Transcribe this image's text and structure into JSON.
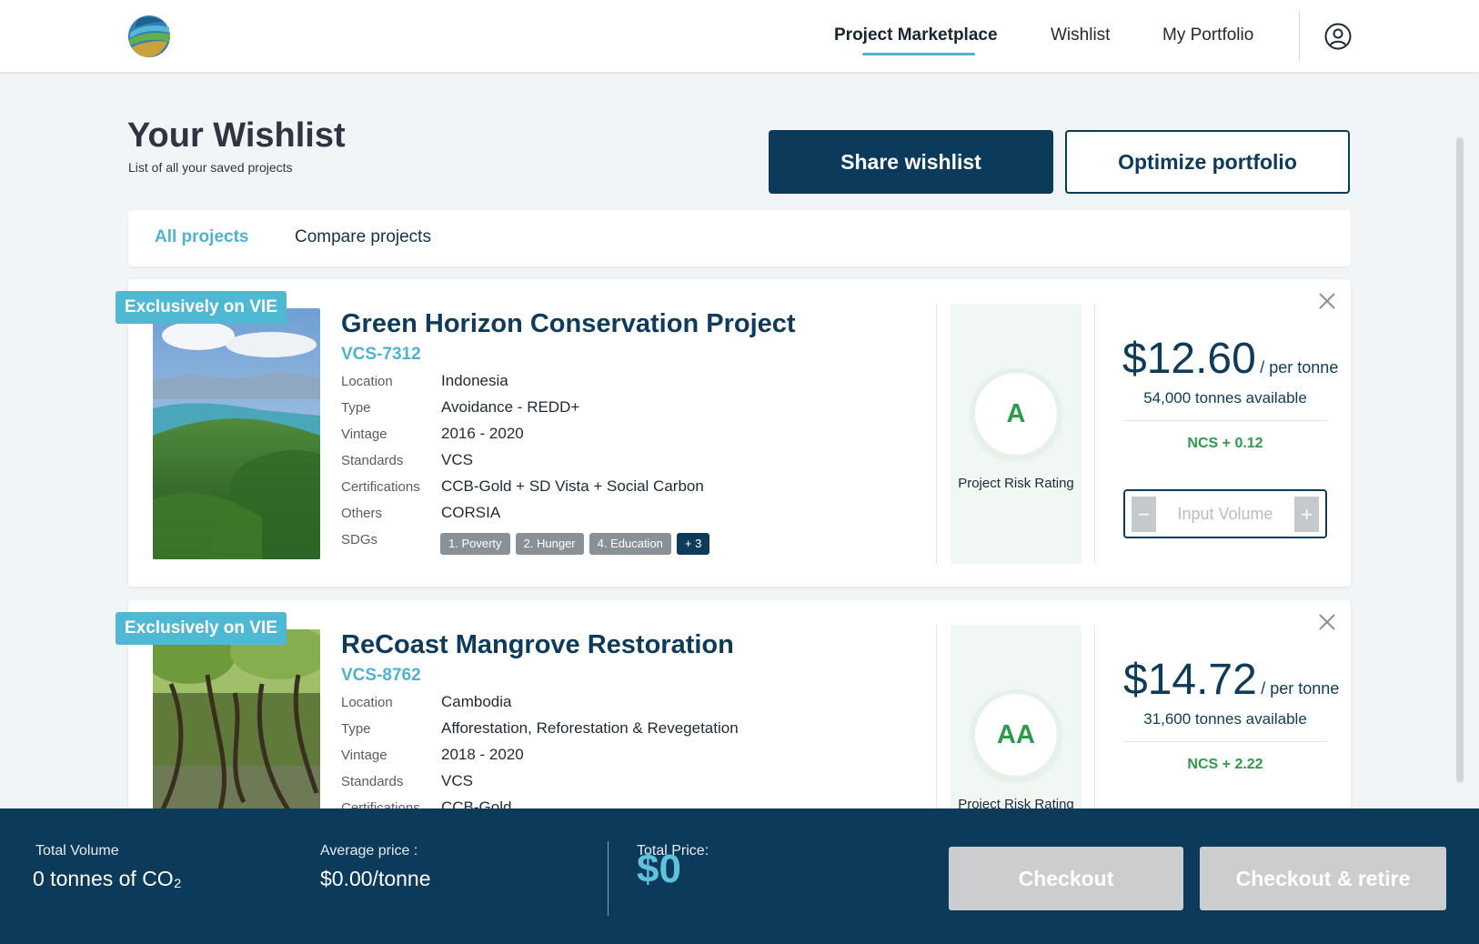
{
  "nav": {
    "items": [
      "Project Marketplace",
      "Wishlist",
      "My Portfolio"
    ]
  },
  "page": {
    "title": "Your Wishlist",
    "subtitle": "List of all your saved projects",
    "share_label": "Share wishlist",
    "optimize_label": "Optimize portfolio"
  },
  "tabs": [
    "All projects",
    "Compare projects"
  ],
  "labels": {
    "location": "Location",
    "type": "Type",
    "vintage": "Vintage",
    "standards": "Standards",
    "certifications": "Certifications",
    "others": "Others",
    "sdgs": "SDGs",
    "risk": "Project Risk Rating",
    "per_tonne": "/ per tonne",
    "input_placeholder": "Input Volume"
  },
  "projects": [
    {
      "badge": "Exclusively on VIE",
      "title": "Green Horizon Conservation Project",
      "code": "VCS-7312",
      "location": "Indonesia",
      "type": "Avoidance - REDD+",
      "vintage": "2016 - 2020",
      "standards": "VCS",
      "certifications": "CCB-Gold + SD Vista + Social Carbon",
      "others": "CORSIA",
      "sdgs": [
        "1. Poverty",
        "2. Hunger",
        "4. Education",
        "+ 3"
      ],
      "rating": "A",
      "price": "$12.60",
      "available": "54,000 tonnes available",
      "ncs": "NCS + 0.12"
    },
    {
      "badge": "Exclusively on VIE",
      "title": "ReCoast Mangrove Restoration",
      "code": "VCS-8762",
      "location": "Cambodia",
      "type": "Afforestation, Reforestation & Revegetation",
      "vintage": "2018 - 2020",
      "standards": "VCS",
      "certifications": "CCB-Gold",
      "rating": "AA",
      "price": "$14.72",
      "available": "31,600 tonnes available",
      "ncs": "NCS + 2.22"
    }
  ],
  "footer": {
    "volume_label": "Total Volume",
    "volume_value": "0 tonnes of CO₂",
    "avg_label": "Average price :",
    "avg_value": "$0.00/tonne",
    "total_label": "Total Price:",
    "total_value": "$0",
    "checkout_label": "Checkout",
    "retire_label": "Checkout & retire"
  },
  "colors": {
    "primary": "#0b3a5b",
    "accent": "#4fb3cf",
    "green": "#2e9a4c",
    "disabled": "#cbcdcf"
  }
}
